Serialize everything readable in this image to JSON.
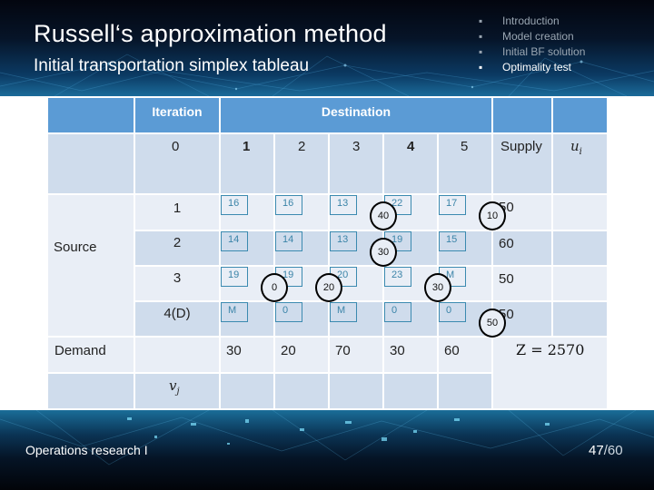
{
  "slide": {
    "title": "Russell‘s approximation method",
    "subtitle": "Initial transportation simplex tableau",
    "agenda": [
      {
        "label": "Introduction",
        "active": false
      },
      {
        "label": "Model creation",
        "active": false
      },
      {
        "label": "Initial BF solution",
        "active": false
      },
      {
        "label": "Optimality test",
        "active": true
      }
    ],
    "bullet": "▪",
    "footer": {
      "course": "Operations research I",
      "page_current": "47",
      "page_separator": "/",
      "page_total": "60"
    },
    "colors": {
      "header_blue": "#5b9bd5",
      "row_dark": "#cfdcec",
      "row_light": "#e9eef6",
      "cost_border": "#3b8ab0"
    }
  },
  "tableau": {
    "header": {
      "iteration_label": "Iteration",
      "destination_label": "Destination"
    },
    "iteration_value": "0",
    "destinations": [
      "1",
      "2",
      "3",
      "4",
      "5"
    ],
    "supply_label": "Supply",
    "ui_label": "u",
    "ui_sub": "i",
    "source_label": "Source",
    "demand_label": "Demand",
    "vj_label": "v",
    "vj_sub": "j",
    "sources": [
      {
        "name": "1",
        "costs": [
          "16",
          "16",
          "13",
          "22",
          "17"
        ],
        "supply": "50"
      },
      {
        "name": "2",
        "costs": [
          "14",
          "14",
          "13",
          "19",
          "15"
        ],
        "supply": "60"
      },
      {
        "name": "3",
        "costs": [
          "19",
          "19",
          "20",
          "23",
          "M"
        ],
        "supply": "50"
      },
      {
        "name": "4(D)",
        "costs": [
          "M",
          "0",
          "M",
          "0",
          "0"
        ],
        "supply": "50"
      }
    ],
    "allocations": [
      {
        "row": 1,
        "col": 3,
        "value": "40"
      },
      {
        "row": 1,
        "col": 5,
        "value": "10"
      },
      {
        "row": 2,
        "col": 3,
        "value": "30"
      },
      {
        "row": 3,
        "col": 1,
        "value": "0"
      },
      {
        "row": 3,
        "col": 2,
        "value": "20"
      },
      {
        "row": 3,
        "col": 4,
        "value": "30"
      },
      {
        "row": 4,
        "col": 5,
        "value": "50"
      }
    ],
    "demand": [
      "30",
      "20",
      "70",
      "30",
      "60"
    ],
    "objective": "Z = 2570"
  }
}
